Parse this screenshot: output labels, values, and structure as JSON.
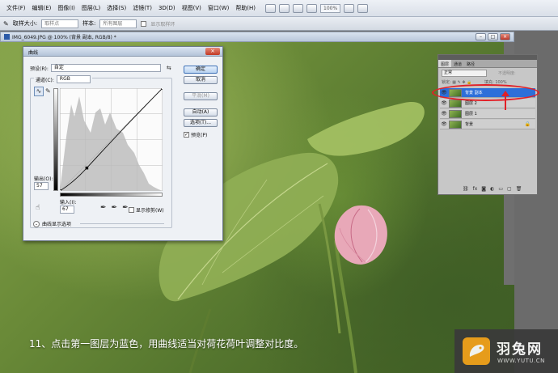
{
  "menubar": {
    "items": [
      "文件(F)",
      "编辑(E)",
      "图像(I)",
      "图层(L)",
      "选择(S)",
      "滤镜(T)",
      "3D(D)",
      "视图(V)",
      "窗口(W)",
      "帮助(H)"
    ],
    "zoom": "100%"
  },
  "options": {
    "sample_size_label": "取样大小:",
    "sample_size_value": "取样点",
    "sample_label": "样本:",
    "sample_value": "所有图层",
    "show_ring_label": "显示取样环"
  },
  "document": {
    "title": "IMG_6049.JPG @ 100% (背景 副本, RGB/8) *"
  },
  "curves": {
    "title": "曲线",
    "preset_label": "预设(R):",
    "preset_value": "自定",
    "channel_label": "通道(C):",
    "channel_value": "RGB",
    "output_label": "输出(O):",
    "output_value": "57",
    "input_label": "输入(I):",
    "input_value": "67",
    "show_clipping_label": "显示修剪(W)",
    "curve_options_label": "曲线显示选项",
    "buttons": {
      "ok": "确定",
      "cancel": "取消",
      "smooth": "平滑(M)",
      "auto": "自动(A)",
      "options": "选项(T)...",
      "preview": "预览(P)"
    },
    "curve_points": [
      [
        0,
        0
      ],
      [
        67,
        57
      ],
      [
        255,
        255
      ]
    ]
  },
  "layers": {
    "tabs": [
      "图层",
      "通道",
      "路径"
    ],
    "blend_mode": "正常",
    "opacity_label": "不透明度:",
    "opacity_value": "100%",
    "lock_label": "锁定:",
    "fill_label": "填充:",
    "fill_value": "100%",
    "items": [
      {
        "name": "背景 副本",
        "active": true
      },
      {
        "name": "图层 2",
        "active": false
      },
      {
        "name": "图层 1",
        "active": false
      },
      {
        "name": "背景",
        "active": false
      }
    ]
  },
  "caption": "11、点击第一图层为蓝色，用曲线适当对荷花荷叶调整对比度。",
  "watermark": {
    "name": "羽兔网",
    "url": "WWW.YUTU.CN"
  },
  "colors": {
    "active_layer": "#2d6fd9",
    "annotation": "#e21f26",
    "logo": "#f5a21b"
  }
}
